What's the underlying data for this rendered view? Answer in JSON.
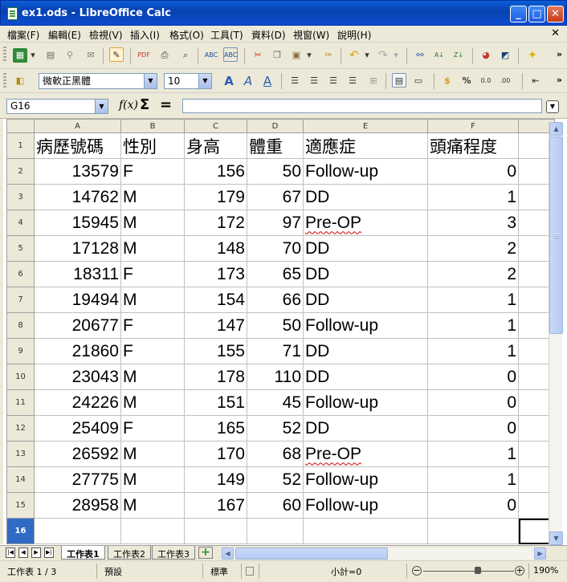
{
  "window": {
    "title": "ex1.ods - LibreOffice Calc",
    "minimize": "_",
    "maximize": "□",
    "close": "✕"
  },
  "menu": {
    "items": [
      "檔案(F)",
      "編輯(E)",
      "檢視(V)",
      "插入(I)",
      "格式(O)",
      "工具(T)",
      "資料(D)",
      "視窗(W)",
      "說明(H)"
    ],
    "doc_close": "✕"
  },
  "format_toolbar": {
    "font_name": "微軟正黑體",
    "font_size": "10"
  },
  "formula_bar": {
    "name_box": "G16",
    "fx": "f(x)",
    "sum": "Σ",
    "equals": "=",
    "content": ""
  },
  "sheet": {
    "columns": [
      "A",
      "B",
      "C",
      "D",
      "E",
      "F"
    ],
    "active_row": "16",
    "header_row": [
      "病歷號碼",
      "性別",
      "身高",
      "體重",
      "適應症",
      "頭痛程度"
    ],
    "rows": [
      {
        "n": "2",
        "cells": [
          "13579",
          "F",
          "156",
          "50",
          "Follow-up",
          "0"
        ]
      },
      {
        "n": "3",
        "cells": [
          "14762",
          "M",
          "179",
          "67",
          "DD",
          "1"
        ]
      },
      {
        "n": "4",
        "cells": [
          "15945",
          "M",
          "172",
          "97",
          "Pre-OP",
          "3"
        ]
      },
      {
        "n": "5",
        "cells": [
          "17128",
          "M",
          "148",
          "70",
          "DD",
          "2"
        ]
      },
      {
        "n": "6",
        "cells": [
          "18311",
          "F",
          "173",
          "65",
          "DD",
          "2"
        ]
      },
      {
        "n": "7",
        "cells": [
          "19494",
          "M",
          "154",
          "66",
          "DD",
          "1"
        ]
      },
      {
        "n": "8",
        "cells": [
          "20677",
          "F",
          "147",
          "50",
          "Follow-up",
          "1"
        ]
      },
      {
        "n": "9",
        "cells": [
          "21860",
          "F",
          "155",
          "71",
          "DD",
          "1"
        ]
      },
      {
        "n": "10",
        "cells": [
          "23043",
          "M",
          "178",
          "110",
          "DD",
          "0"
        ]
      },
      {
        "n": "11",
        "cells": [
          "24226",
          "M",
          "151",
          "45",
          "Follow-up",
          "0"
        ]
      },
      {
        "n": "12",
        "cells": [
          "25409",
          "F",
          "165",
          "52",
          "DD",
          "0"
        ]
      },
      {
        "n": "13",
        "cells": [
          "26592",
          "M",
          "170",
          "68",
          "Pre-OP",
          "1"
        ]
      },
      {
        "n": "14",
        "cells": [
          "27775",
          "M",
          "149",
          "52",
          "Follow-up",
          "1"
        ]
      },
      {
        "n": "15",
        "cells": [
          "28958",
          "M",
          "167",
          "60",
          "Follow-up",
          "0"
        ]
      }
    ]
  },
  "tabs": {
    "sheets": [
      "工作表1",
      "工作表2",
      "工作表3"
    ],
    "active": "工作表1"
  },
  "status": {
    "sheet_pos": "工作表 1 / 3",
    "page_style": "預設",
    "mode": "標準",
    "sum": "小計=0",
    "zoom": "190%"
  }
}
